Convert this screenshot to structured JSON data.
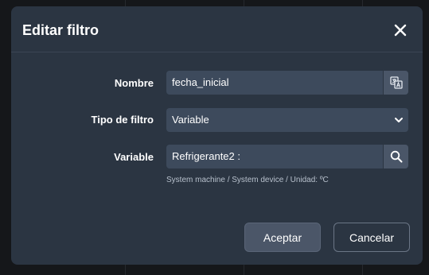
{
  "dialog": {
    "title": "Editar filtro",
    "close_icon": "close-icon"
  },
  "form": {
    "name": {
      "label": "Nombre",
      "value": "fecha_inicial",
      "addon_icon": "translate-icon"
    },
    "filter_type": {
      "label": "Tipo de filtro",
      "selected": "Variable"
    },
    "variable": {
      "label": "Variable",
      "value": "Refrigerante2 :",
      "addon_icon": "search-icon",
      "help": "System machine / System device / Unidad: ºC"
    }
  },
  "footer": {
    "accept_label": "Aceptar",
    "cancel_label": "Cancelar"
  },
  "colors": {
    "modal_bg": "#2b3542",
    "field_bg": "#3d4a5c",
    "addon_bg": "#4a5668",
    "text": "#ffffff",
    "muted_text": "#b7c0cc"
  }
}
